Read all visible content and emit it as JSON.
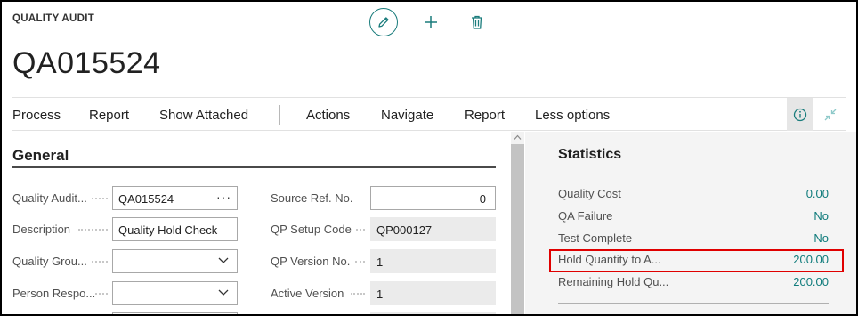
{
  "page": {
    "caption": "QUALITY AUDIT",
    "title": "QA015524"
  },
  "top_icons": [
    "edit-icon",
    "add-icon",
    "delete-icon"
  ],
  "actions": [
    "Process",
    "Report",
    "Show Attached",
    "Actions",
    "Navigate",
    "Report",
    "Less options"
  ],
  "general": {
    "title": "General",
    "left": [
      {
        "label": "Quality Audit...",
        "value": "QA015524",
        "kind": "lookup"
      },
      {
        "label": "Description",
        "value": "Quality Hold Check",
        "kind": "text"
      },
      {
        "label": "Quality Grou...",
        "value": "",
        "kind": "select"
      },
      {
        "label": "Person Respo...",
        "value": "",
        "kind": "select"
      }
    ],
    "right": [
      {
        "label": "Source Ref. No.",
        "value": "0",
        "kind": "number"
      },
      {
        "label": "QP Setup Code",
        "value": "QP000127",
        "kind": "readonly"
      },
      {
        "label": "QP Version No.",
        "value": "1",
        "kind": "readonly"
      },
      {
        "label": "Active Version",
        "value": "1",
        "kind": "readonly"
      }
    ]
  },
  "statistics": {
    "title": "Statistics",
    "rows": [
      {
        "label": "Quality Cost",
        "value": "0.00"
      },
      {
        "label": "QA Failure",
        "value": "No"
      },
      {
        "label": "Test Complete",
        "value": "No"
      },
      {
        "label": "Hold Quantity to A...",
        "value": "200.00"
      },
      {
        "label": "Remaining Hold Qu...",
        "value": "200.00"
      }
    ]
  },
  "colors": {
    "accent": "#0f7b7b",
    "highlight": "#e00000"
  }
}
